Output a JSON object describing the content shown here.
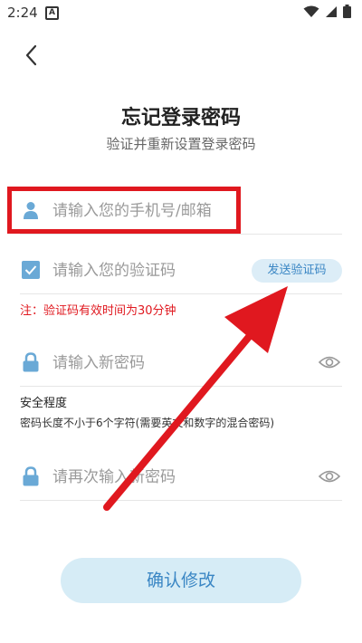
{
  "status_bar": {
    "time": "2:24",
    "notification_letter": "A"
  },
  "header": {
    "title": "忘记登录密码",
    "subtitle": "验证并重新设置登录密码"
  },
  "form": {
    "phone_placeholder": "请输入您的手机号/邮箱",
    "code_placeholder": "请输入您的验证码",
    "send_code_label": "发送验证码",
    "note": "注：验证码有效时间为30分钟",
    "new_password_placeholder": "请输入新密码",
    "strength_title": "安全程度",
    "strength_desc": "密码长度不小于6个字符(需要英文和数字的混合密码)",
    "confirm_password_placeholder": "请再次输入新密码",
    "confirm_label": "确认修改"
  },
  "colors": {
    "accent": "#3a86c4",
    "icon_blue": "#6aa9d6",
    "highlight_red": "#e0181f",
    "button_bg": "#d6ecf6"
  },
  "icons": [
    "back-arrow",
    "user",
    "checkbox",
    "lock",
    "eye",
    "wifi",
    "battery"
  ]
}
